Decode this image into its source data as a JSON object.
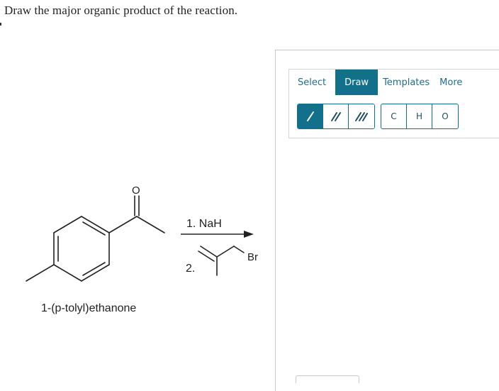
{
  "question": {
    "prompt": "Draw the major organic product of the reaction."
  },
  "scheme": {
    "oxygen_label": "O",
    "reagent_1": "1. NaH",
    "reagent_2_number": "2.",
    "bromine_label": "Br",
    "reactant_name": "1-(p-tolyl)ethanone"
  },
  "editor": {
    "tabs": [
      {
        "label": "Select",
        "active": false
      },
      {
        "label": "Draw",
        "active": true
      },
      {
        "label": "Templates",
        "active": false
      },
      {
        "label": "More",
        "active": false
      }
    ],
    "bond_tools": [
      {
        "icon": "single-bond-icon",
        "active": true
      },
      {
        "icon": "double-bond-icon",
        "active": false
      },
      {
        "icon": "triple-bond-icon",
        "active": false
      }
    ],
    "atom_tools": [
      "C",
      "H",
      "O"
    ]
  },
  "colors": {
    "accent": "#13708a",
    "border": "#c8c8c8"
  }
}
